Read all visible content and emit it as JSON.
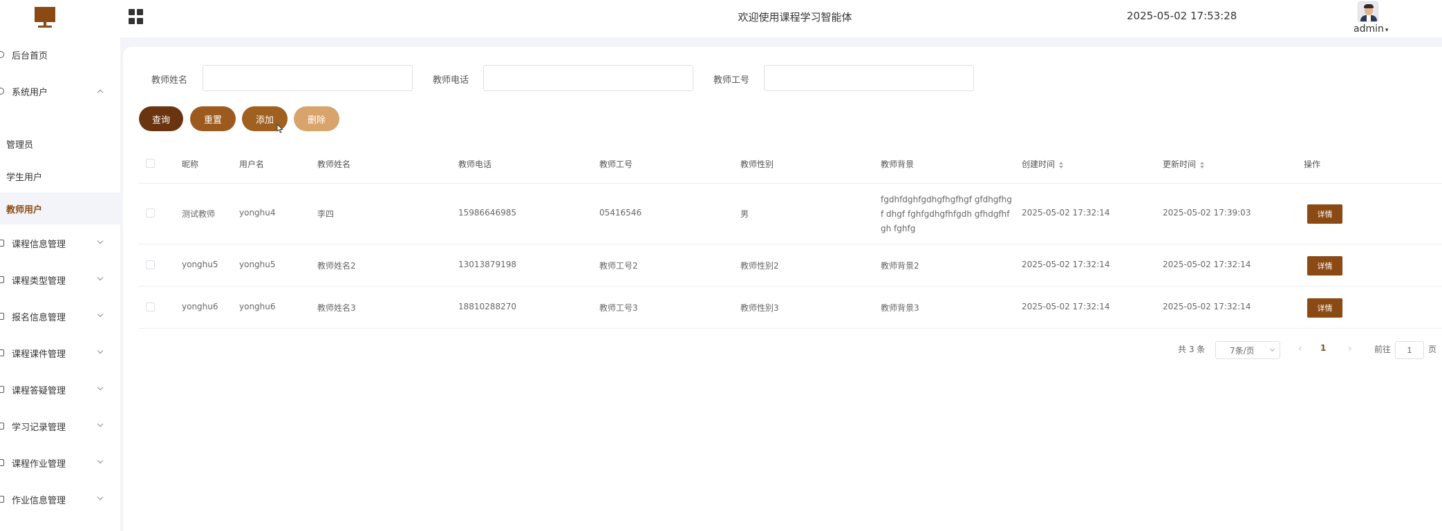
{
  "header": {
    "title": "欢迎使用课程学习智能体",
    "datetime": "2025-05-02 17:53:28",
    "username": "admin",
    "caret": "▾"
  },
  "sidebar": {
    "items": [
      {
        "label": "后台首页"
      },
      {
        "label": "系统用户"
      },
      {
        "label": "管理员"
      },
      {
        "label": "学生用户"
      },
      {
        "label": "教师用户"
      },
      {
        "label": "课程信息管理"
      },
      {
        "label": "课程类型管理"
      },
      {
        "label": "报名信息管理"
      },
      {
        "label": "课程课件管理"
      },
      {
        "label": "课程答疑管理"
      },
      {
        "label": "学习记录管理"
      },
      {
        "label": "课程作业管理"
      },
      {
        "label": "作业信息管理"
      }
    ]
  },
  "search": {
    "name_label": "教师姓名",
    "phone_label": "教师电话",
    "id_label": "教师工号"
  },
  "buttons": {
    "query": "查询",
    "reset": "重置",
    "add": "添加",
    "delete": "删除"
  },
  "table": {
    "columns": [
      "昵称",
      "用户名",
      "教师姓名",
      "教师电话",
      "教师工号",
      "教师性别",
      "教师背景",
      "创建时间",
      "更新时间",
      "操作"
    ],
    "rows": [
      {
        "nickname": "测试教师",
        "username": "yonghu4",
        "name": "李四",
        "phone": "15986646985",
        "teacher_id": "05416546",
        "gender": "男",
        "background": "fgdhfdghfgdhgfhgfhgf gfdhgfhgf dhgf fghfgdhgfhfgdh gfhdgfhfgh fghfg",
        "created": "2025-05-02 17:32:14",
        "updated": "2025-05-02 17:39:03",
        "action": "详情"
      },
      {
        "nickname": "yonghu5",
        "username": "yonghu5",
        "name": "教师姓名2",
        "phone": "13013879198",
        "teacher_id": "教师工号2",
        "gender": "教师性别2",
        "background": "教师背景2",
        "created": "2025-05-02 17:32:14",
        "updated": "2025-05-02 17:32:14",
        "action": "详情"
      },
      {
        "nickname": "yonghu6",
        "username": "yonghu6",
        "name": "教师姓名3",
        "phone": "18810288270",
        "teacher_id": "教师工号3",
        "gender": "教师性别3",
        "background": "教师背景3",
        "created": "2025-05-02 17:32:14",
        "updated": "2025-05-02 17:32:14",
        "action": "详情"
      }
    ]
  },
  "pagination": {
    "total": "共 3 条",
    "page_size": "7条/页",
    "prev": "‹",
    "current": "1",
    "next": "›",
    "goto_label": "前往",
    "goto_value": "1",
    "page_suffix": "页"
  },
  "colors": {
    "brand": "#8b4a13",
    "btn_query": "#6b3410",
    "btn_reset": "#9c5a1f",
    "btn_add": "#a0601f",
    "btn_delete": "#d9a46b"
  }
}
